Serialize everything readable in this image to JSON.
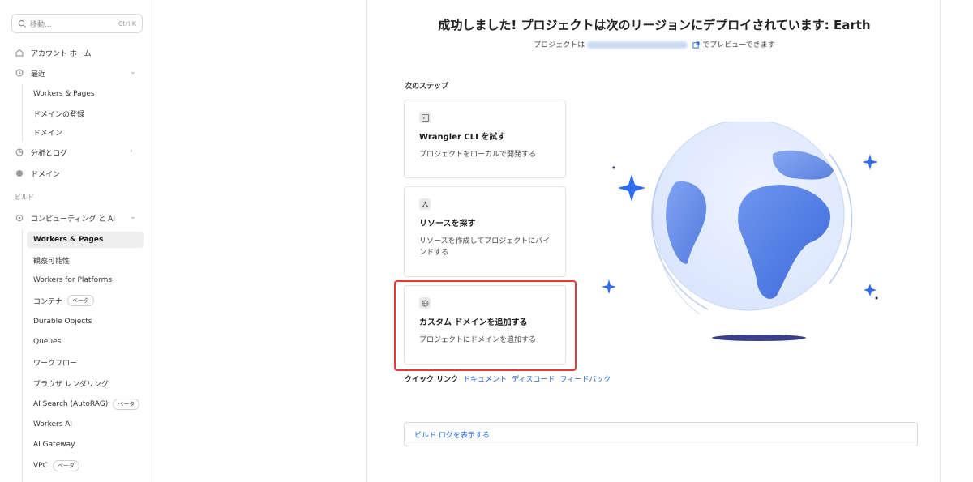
{
  "search": {
    "placeholder": "移動...",
    "shortcut": "Ctrl K"
  },
  "sidebar": {
    "top_items": [
      {
        "label": "アカウント ホーム",
        "icon": "home-icon"
      },
      {
        "label": "最近",
        "icon": "clock-icon"
      }
    ],
    "recent_items": [
      "Workers & Pages",
      "ドメインの登録",
      "ドメイン"
    ],
    "analytics": {
      "label": "分析とログ",
      "icon": "chart-icon"
    },
    "domains": {
      "label": "ドメイン",
      "icon": "globe-icon"
    },
    "section_build": "ビルド",
    "compute": {
      "label": "コンピューティング と AI",
      "icon": "compute-icon"
    },
    "compute_items": [
      {
        "label": "Workers & Pages",
        "active": true
      },
      {
        "label": "観察可能性"
      },
      {
        "label": "Workers for Platforms"
      },
      {
        "label": "コンテナ",
        "badge": "ベータ"
      },
      {
        "label": "Durable Objects"
      },
      {
        "label": "Queues"
      },
      {
        "label": "ワークフロー"
      },
      {
        "label": "ブラウザ レンダリング"
      },
      {
        "label": "AI Search (AutoRAG)",
        "badge": "ベータ"
      },
      {
        "label": "Workers AI"
      },
      {
        "label": "AI Gateway"
      },
      {
        "label": "VPC",
        "badge": "ベータ"
      }
    ]
  },
  "main": {
    "title": "成功しました! プロジェクトは次のリージョンにデプロイされています: Earth",
    "subtitle_prefix": "プロジェクトは",
    "subtitle_suffix": "でプレビューできます",
    "steps_label": "次のステップ",
    "cards": [
      {
        "title": "Wrangler CLI を試す",
        "desc": "プロジェクトをローカルで開発する",
        "icon": "terminal-icon"
      },
      {
        "title": "リソースを探す",
        "desc": "リソースを作成してプロジェクトにバインドする",
        "icon": "resource-icon"
      },
      {
        "title": "カスタム ドメインを追加する",
        "desc": "プロジェクトにドメインを追加する",
        "icon": "globe-icon"
      }
    ],
    "quick_links_label": "クイック リンク",
    "quick_links": [
      "ドキュメント",
      "ディスコード",
      "フィードバック"
    ],
    "build_log_label": "ビルド ログを表示する"
  },
  "colors": {
    "accent": "#1d63d6",
    "highlight": "#e03a3a",
    "globe": "#4a7be8"
  }
}
